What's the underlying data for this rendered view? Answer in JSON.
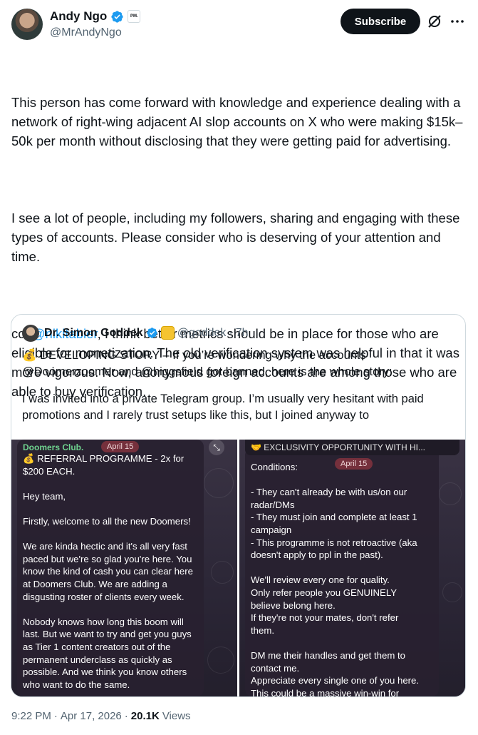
{
  "author": {
    "name": "Andy Ngo",
    "handle": "@MrAndyNgo",
    "affiliate_badge": "PM."
  },
  "header": {
    "subscribe_label": "Subscribe",
    "grok_icon": "grok-icon",
    "more_icon": "more-icon"
  },
  "tweet": {
    "paragraph1": "This person has come forward with knowledge and experience dealing with a network of right-wing adjacent AI slop accounts on X who were making $15k–50k per month without disclosing that they were getting paid for advertising.",
    "paragraph2": "I see a lot of people, including my followers, sharing and engaging with these types of accounts. Please consider who is deserving of your attention and time.",
    "paragraph3_prefix": "cc: ",
    "paragraph3_mention": "@nikitabier",
    "paragraph3_rest": ", I think better metrics should be in place for those who are eligible for monetization. The old verification system was helpful in that it was more vigorous. Now, anonymous foreign accounts are among those who are able to buy verification."
  },
  "quote": {
    "name": "Dr. Simon Goddek",
    "handle": "@goddek",
    "separator": "·",
    "time": "7h",
    "paragraph1": "💰 DEVELOPING STORY – If you’re wondering why the accounts @Doomerzoomer and @higgsfield got banned, here is the whole story:",
    "paragraph2": "I was invited into a private Telegram group. I’m usually very hesitant with paid promotions and I rarely trust setups like this, but I joined anyway to",
    "image_left": {
      "group": "Doomers Club.",
      "date": "April 15",
      "text": "💰 REFERRAL PROGRAMME - 2x for\n$200 EACH.\n\nHey team,\n\nFirstly, welcome to all the new Doomers!\n\nWe are kinda hectic and it's all very fast\npaced but we're so glad you're here. You\nknow the kind of cash you can clear here\nat Doomers Club. We are adding a\ndisgusting roster of clients every week.\n\nNobody knows how long this boom will\nlast. But we want to try and get you guys\nas Tier 1 content creators out of the\npermanent underclass as quickly as\npossible. And we think you know others\nwho want to do the same."
    },
    "image_right": {
      "pinned": "🤝 EXCLUSIVITY OPPORTUNITY WITH HI...",
      "date": "April 15",
      "text": "Conditions:\n\n- They can't already be with us/on our\nradar/DMs\n- They must join and complete at least 1\ncampaign\n- This programme is not retroactive (aka\ndoesn't apply to ppl in the past).\n\nWe'll review every one for quality.\nOnly refer people you GENUINELY\nbelieve belong here.\nIf they're not your mates, don't refer\nthem.\n\nDM me their handles and get them to\ncontact me.\nAppreciate every single one of you here.\nThis could be a massive win-win for"
    }
  },
  "footer": {
    "time": "9:22 PM",
    "dot": "·",
    "date": "Apr 17, 2026",
    "dot2": "·",
    "views_count": "20.1K",
    "views_label": "Views"
  },
  "colors": {
    "link": "#1d9bf0",
    "verified": "#1d9bf0",
    "text": "#0f1419",
    "muted": "#536471"
  }
}
